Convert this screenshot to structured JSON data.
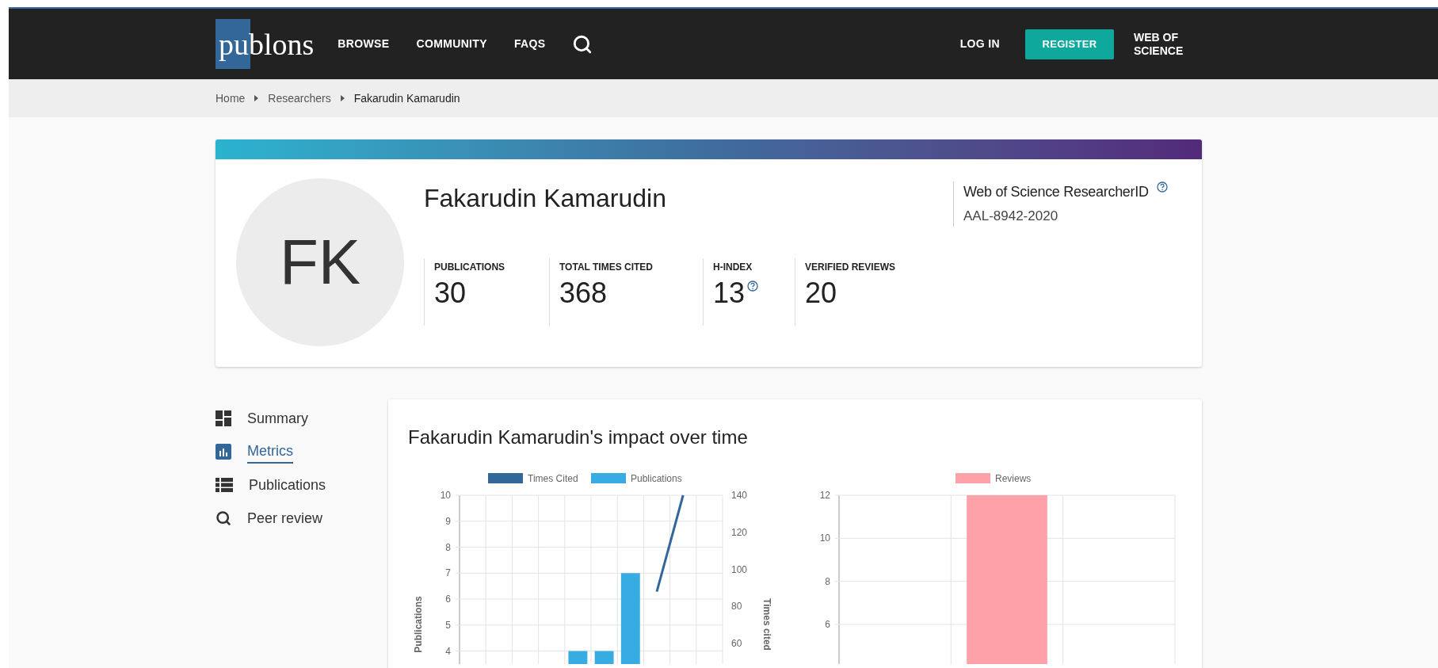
{
  "nav": {
    "logo": "publons",
    "links": [
      {
        "label": "BROWSE"
      },
      {
        "label": "COMMUNITY"
      },
      {
        "label": "FAQS"
      }
    ],
    "login": "LOG IN",
    "register": "REGISTER",
    "wos": "WEB OF SCIENCE"
  },
  "breadcrumb": [
    "Home",
    "Researchers",
    "Fakarudin Kamarudin"
  ],
  "profile": {
    "initials": "FK",
    "name": "Fakarudin Kamarudin",
    "rid_label": "Web of Science ResearcherID",
    "rid": "AAL-8942-2020",
    "metrics": [
      {
        "label": "PUBLICATIONS",
        "value": "30",
        "help": false
      },
      {
        "label": "TOTAL TIMES CITED",
        "value": "368",
        "help": false
      },
      {
        "label": "H-INDEX",
        "value": "13",
        "help": true
      },
      {
        "label": "VERIFIED REVIEWS",
        "value": "20",
        "help": false
      }
    ]
  },
  "sidebar": {
    "items": [
      {
        "kind": "summary",
        "label": "Summary",
        "selected": false
      },
      {
        "kind": "metrics",
        "label": "Metrics",
        "selected": true
      },
      {
        "kind": "publications",
        "label": "Publications",
        "selected": false
      },
      {
        "kind": "search",
        "label": "Peer review",
        "selected": false
      }
    ]
  },
  "impact": {
    "title": "Fakarudin Kamarudin's impact over time",
    "charts": [
      {
        "chart_data": {
          "type": "bar",
          "ylabel": "Publications",
          "y2label": "Times cited",
          "legend": "top",
          "grid": true,
          "ylim": [
            3.5,
            10
          ],
          "yticks": [
            4,
            5,
            6,
            7,
            8,
            9,
            10
          ],
          "y2lim": [
            49,
            140
          ],
          "y2ticks": [
            60,
            80,
            100,
            120,
            140
          ],
          "series": [
            {
              "name": "Times Cited",
              "color": "#336699",
              "type": "line",
              "axis": "y2",
              "values": [
                null,
                null,
                null,
                null,
                null,
                null,
                null,
                88,
                140,
                null
              ]
            },
            {
              "name": "Publications",
              "color": "#36ace2",
              "values": [
                null,
                null,
                null,
                null,
                4,
                4,
                7,
                null,
                null,
                null
              ]
            }
          ]
        }
      },
      {
        "chart_data": {
          "type": "bar",
          "legend": "top",
          "grid": true,
          "ylim": [
            4.16,
            12
          ],
          "yticks": [
            6,
            8,
            10,
            12
          ],
          "series": [
            {
              "name": "Reviews",
              "color": "#ffa1a8",
              "values": [
                null,
                12,
                null
              ]
            }
          ]
        }
      }
    ]
  }
}
